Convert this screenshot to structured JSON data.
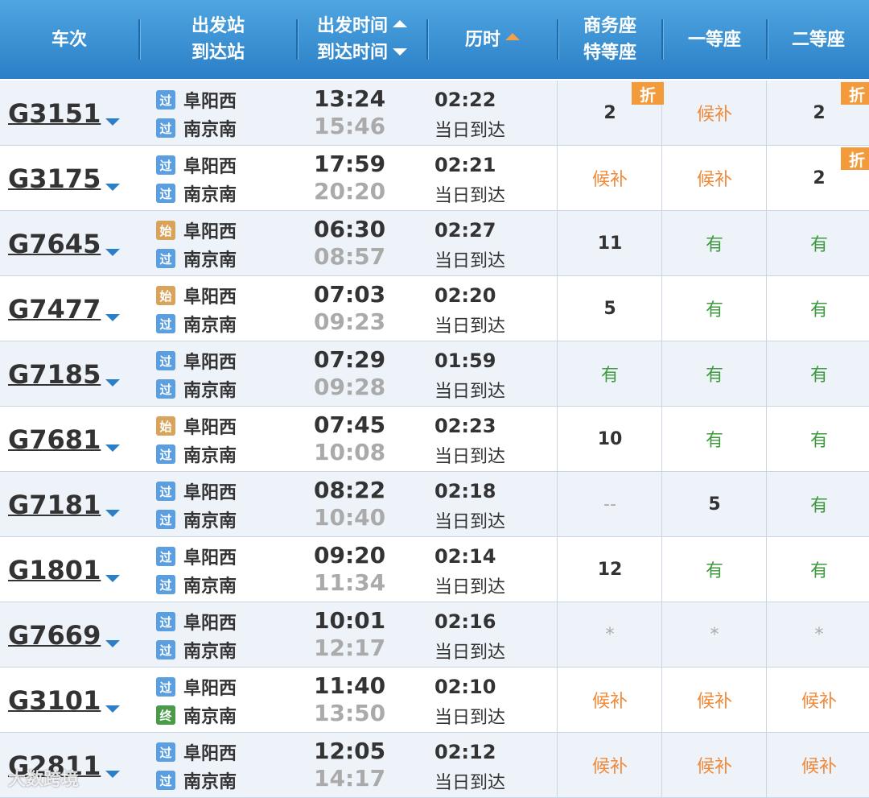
{
  "header": {
    "train": "车次",
    "station_top": "出发站",
    "station_bottom": "到达站",
    "time_top": "出发时间",
    "time_bottom": "到达时间",
    "duration": "历时",
    "biz_top": "商务座",
    "biz_bottom": "特等座",
    "first": "一等座",
    "second": "二等座"
  },
  "discount_label": "折",
  "watermark": "大数跨境",
  "rows": [
    {
      "train": "G3151",
      "from_badge": "过",
      "from": "阜阳西",
      "to_badge": "过",
      "to": "南京南",
      "dep": "13:24",
      "arr": "15:46",
      "dur": "02:22",
      "arrive_day": "当日到达",
      "biz": "2",
      "first": "候补",
      "second": "2"
    },
    {
      "train": "G3175",
      "from_badge": "过",
      "from": "阜阳西",
      "to_badge": "过",
      "to": "南京南",
      "dep": "17:59",
      "arr": "20:20",
      "dur": "02:21",
      "arrive_day": "当日到达",
      "biz": "候补",
      "first": "候补",
      "second": "2"
    },
    {
      "train": "G7645",
      "from_badge": "始",
      "from": "阜阳西",
      "to_badge": "过",
      "to": "南京南",
      "dep": "06:30",
      "arr": "08:57",
      "dur": "02:27",
      "arrive_day": "当日到达",
      "biz": "11",
      "first": "有",
      "second": "有"
    },
    {
      "train": "G7477",
      "from_badge": "始",
      "from": "阜阳西",
      "to_badge": "过",
      "to": "南京南",
      "dep": "07:03",
      "arr": "09:23",
      "dur": "02:20",
      "arrive_day": "当日到达",
      "biz": "5",
      "first": "有",
      "second": "有"
    },
    {
      "train": "G7185",
      "from_badge": "过",
      "from": "阜阳西",
      "to_badge": "过",
      "to": "南京南",
      "dep": "07:29",
      "arr": "09:28",
      "dur": "01:59",
      "arrive_day": "当日到达",
      "biz": "有",
      "first": "有",
      "second": "有"
    },
    {
      "train": "G7681",
      "from_badge": "始",
      "from": "阜阳西",
      "to_badge": "过",
      "to": "南京南",
      "dep": "07:45",
      "arr": "10:08",
      "dur": "02:23",
      "arrive_day": "当日到达",
      "biz": "10",
      "first": "有",
      "second": "有"
    },
    {
      "train": "G7181",
      "from_badge": "过",
      "from": "阜阳西",
      "to_badge": "过",
      "to": "南京南",
      "dep": "08:22",
      "arr": "10:40",
      "dur": "02:18",
      "arrive_day": "当日到达",
      "biz": "--",
      "first": "5",
      "second": "有"
    },
    {
      "train": "G1801",
      "from_badge": "过",
      "from": "阜阳西",
      "to_badge": "过",
      "to": "南京南",
      "dep": "09:20",
      "arr": "11:34",
      "dur": "02:14",
      "arrive_day": "当日到达",
      "biz": "12",
      "first": "有",
      "second": "有"
    },
    {
      "train": "G7669",
      "from_badge": "过",
      "from": "阜阳西",
      "to_badge": "过",
      "to": "南京南",
      "dep": "10:01",
      "arr": "12:17",
      "dur": "02:16",
      "arrive_day": "当日到达",
      "biz": "*",
      "first": "*",
      "second": "*"
    },
    {
      "train": "G3101",
      "from_badge": "过",
      "from": "阜阳西",
      "to_badge": "终",
      "to": "南京南",
      "dep": "11:40",
      "arr": "13:50",
      "dur": "02:10",
      "arrive_day": "当日到达",
      "biz": "候补",
      "first": "候补",
      "second": "候补"
    },
    {
      "train": "G2811",
      "from_badge": "过",
      "from": "阜阳西",
      "to_badge": "过",
      "to": "南京南",
      "dep": "12:05",
      "arr": "14:17",
      "dur": "02:12",
      "arrive_day": "当日到达",
      "biz": "候补",
      "first": "候补",
      "second": "候补"
    }
  ]
}
